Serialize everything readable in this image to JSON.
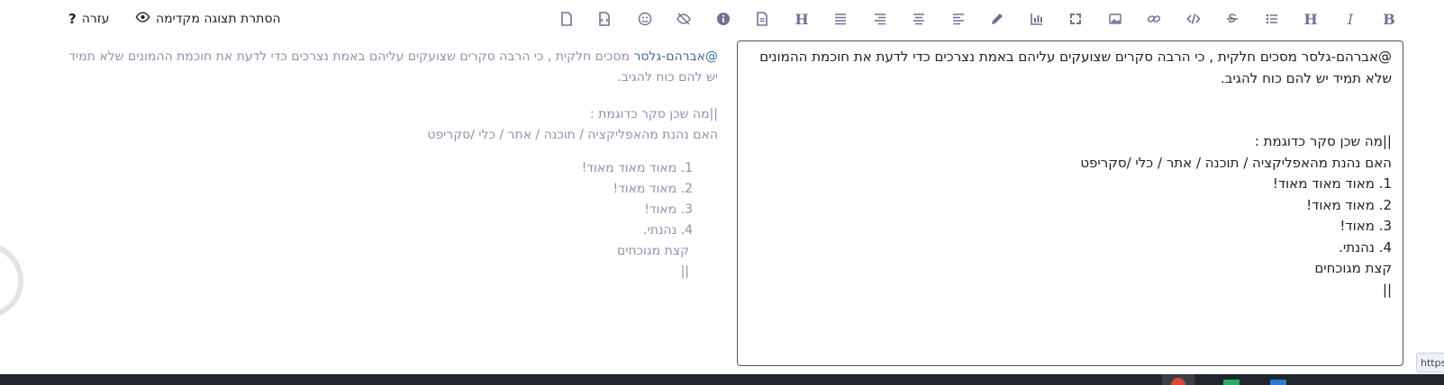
{
  "toolbar": {
    "help_label": "עזרה",
    "help_icon": "?",
    "preview_toggle_label": "הסתרת תצוגה מקדימה",
    "buttons": {
      "bold": "B",
      "italic": "I",
      "heading": "H",
      "heading_alt": "H"
    }
  },
  "preview": {
    "mention": "@אברהם-גלסר",
    "para1": " מסכים חלקית , כי הרבה סקרים שצועקים עליהם באמת נצרכים כדי לדעת את חוכמת ההמונים שלא תמיד יש להם כוח להגיב.",
    "line_q": "||מה שכן סקר כדוגמת :",
    "line_app": "האם נהנת מהאפליקציה / תוכנה / אתר / כלי /סקריפט",
    "list": [
      "1. מאוד מאוד מאוד!",
      "2. מאוד מאוד!",
      "3. מאוד!",
      "4. נהנתי."
    ],
    "after_list": "קצת מגוכחים",
    "tail": "||"
  },
  "editor": {
    "value": "@אברהם-גלסר מסכים חלקית , כי הרבה סקרים שצועקים עליהם באמת נצרכים כדי לדעת את חוכמת ההמונים  שלא תמיד יש להם כוח להגיב.\n\n\n||מה שכן סקר כדוגמת :\nהאם נהנת מהאפליקציה / תוכנה / אתר / כלי /סקריפט\n1. מאוד מאוד מאוד!\n2. מאוד מאוד!\n3. מאוד!\n4. נהנתי.\nקצת מגוכחים\n||"
  },
  "url_hint": "https",
  "colors": {
    "toolbar_icon": "#7b6c93",
    "preview_text": "#9a8caf",
    "mention": "#3f6ba6",
    "taskbar": "#20262c"
  }
}
